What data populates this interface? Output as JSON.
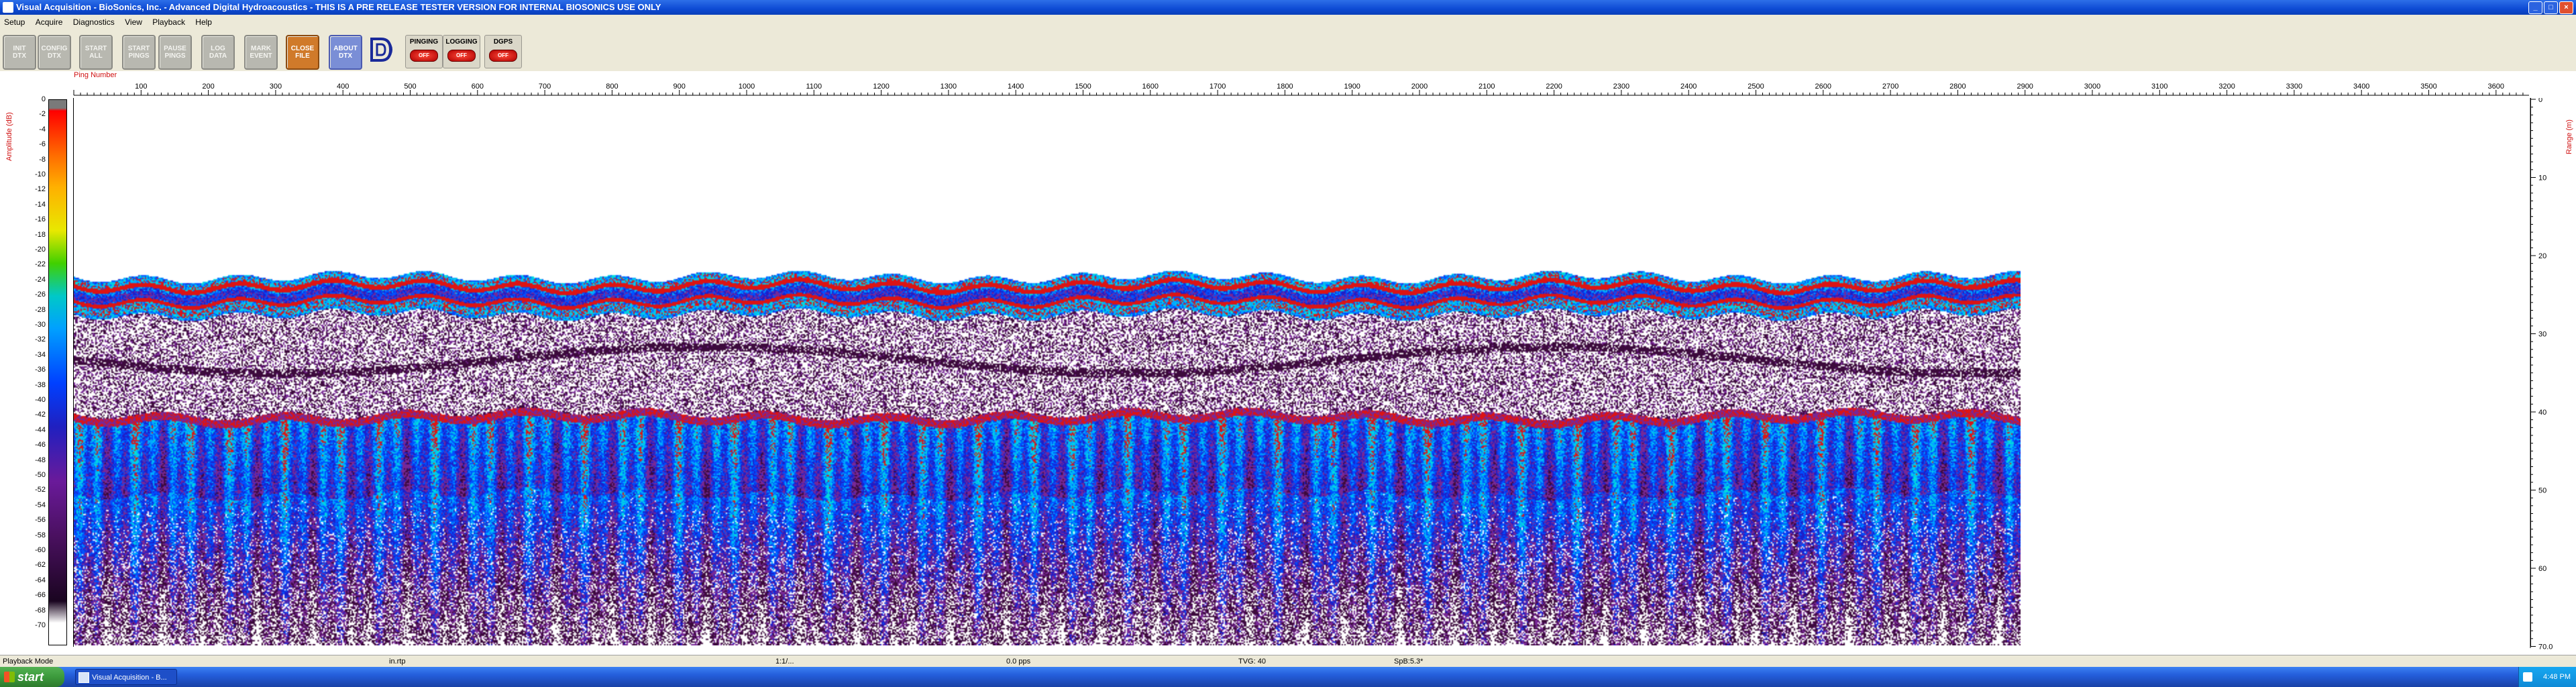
{
  "window": {
    "title": "Visual Acquisition  -  BioSonics, Inc.  -  Advanced Digital Hydroacoustics  -  THIS IS A PRE RELEASE TESTER VERSION FOR INTERNAL BIOSONICS USE ONLY"
  },
  "menu": [
    "Setup",
    "Acquire",
    "Diagnostics",
    "View",
    "Playback",
    "Help"
  ],
  "toolbar": {
    "buttons": [
      {
        "label": "INIT\nDTX"
      },
      {
        "label": "CONFIG\nDTX"
      },
      {
        "label": "START\nALL"
      },
      {
        "label": "START\nPINGS"
      },
      {
        "label": "PAUSE\nPINGS"
      },
      {
        "label": "LOG\nDATA"
      },
      {
        "label": "MARK\nEVENT"
      },
      {
        "label": "CLOSE\nFILE"
      },
      {
        "label": "ABOUT\nDTX"
      }
    ],
    "status": [
      {
        "label": "PINGING",
        "state": "OFF"
      },
      {
        "label": "LOGGING",
        "state": "OFF"
      },
      {
        "label": "DGPS",
        "state": "OFF"
      }
    ],
    "logo_icon": "biosonics-logo-icon"
  },
  "plot": {
    "ping_axis_label": "Ping Number",
    "ping_ticks": [
      "100",
      "200",
      "300",
      "400",
      "500",
      "600",
      "700",
      "800",
      "900",
      "1000",
      "1100",
      "1200",
      "1300",
      "1400",
      "1500",
      "1600",
      "1700",
      "1800",
      "1900",
      "2000",
      "2100",
      "2200",
      "2300",
      "2400",
      "2500",
      "2600",
      "2700",
      "2800",
      "2900",
      "3000",
      "3100",
      "3200",
      "3300",
      "3400",
      "3500",
      "3600"
    ],
    "amplitude_axis_label": "Amplitude (dB)",
    "amplitude_ticks": [
      "0",
      "-2",
      "-4",
      "-6",
      "-8",
      "-10",
      "-12",
      "-14",
      "-16",
      "-18",
      "-20",
      "-22",
      "-24",
      "-26",
      "-28",
      "-30",
      "-32",
      "-34",
      "-36",
      "-38",
      "-40",
      "-42",
      "-44",
      "-46",
      "-48",
      "-50",
      "-52",
      "-54",
      "-56",
      "-58",
      "-60",
      "-62",
      "-64",
      "-66",
      "-68",
      "-70"
    ],
    "range_axis_label": "Range (m)",
    "range_ticks": [
      "0",
      "10",
      "20",
      "30",
      "40",
      "50",
      "60",
      "70.0"
    ],
    "colors": {
      "axis_label": "#d01010"
    }
  },
  "statusbar": {
    "mode": "Playback Mode",
    "file": "in.rtp",
    "time": "1:1/...",
    "rate": "0.0 pps",
    "tvg": "TVG: 40",
    "spb": "SpB:5.3*"
  },
  "taskbar": {
    "start": "start",
    "task": "Visual Acquisition  -  B...",
    "clock": "4:48 PM"
  }
}
